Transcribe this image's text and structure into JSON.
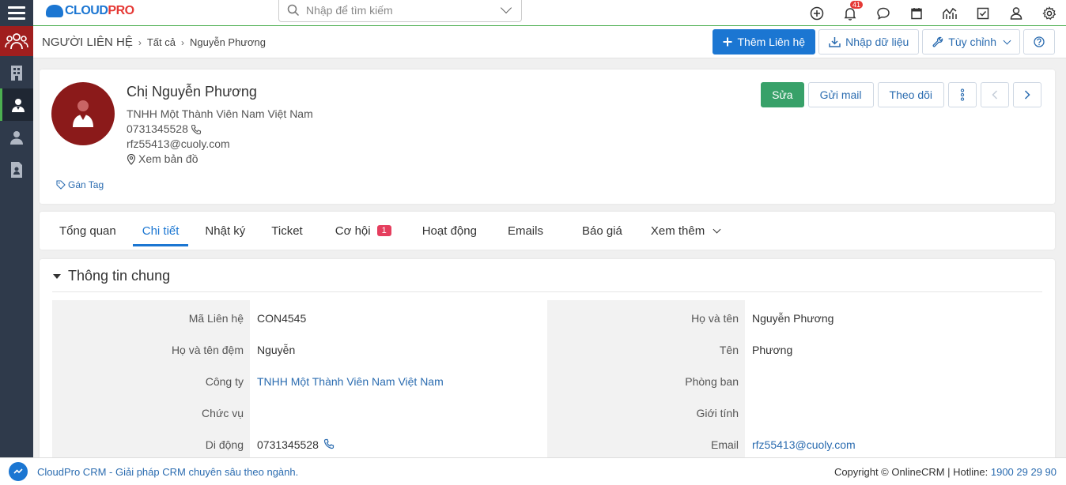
{
  "app": {
    "logo_main": "CLOUD",
    "logo_accent": "PRO"
  },
  "search": {
    "placeholder": "Nhập để tìm kiếm"
  },
  "top_icons": {
    "notification_count": "41"
  },
  "breadcrumb": {
    "module": "Người liên hệ",
    "level1": "Tất cả",
    "level2": "Nguyễn Phương"
  },
  "header_actions": {
    "add": "Thêm Liên hệ",
    "import": "Nhập dữ liệu",
    "customize": "Tùy chỉnh"
  },
  "profile": {
    "name": "Chị Nguyễn Phương",
    "company": "TNHH Một Thành Viên Nam Việt Nam",
    "phone": "0731345528",
    "email": "rfz55413@cuoly.com",
    "map": "Xem bản đồ",
    "tag": "Gán Tag",
    "actions": {
      "edit": "Sửa",
      "send_mail": "Gửi mail",
      "follow": "Theo dõi"
    }
  },
  "tabs": [
    {
      "label": "Tổng quan"
    },
    {
      "label": "Chi tiết"
    },
    {
      "label": "Nhật ký"
    },
    {
      "label": "Ticket"
    },
    {
      "label": "Cơ hội",
      "badge": "1"
    },
    {
      "label": "Hoạt động"
    },
    {
      "label": "Emails"
    },
    {
      "label": "Báo giá"
    },
    {
      "label": "Xem thêm"
    }
  ],
  "section": {
    "title": "Thông tin chung"
  },
  "fields": {
    "left": [
      {
        "label": "Mã Liên hệ",
        "value": "CON4545"
      },
      {
        "label": "Họ và tên đệm",
        "value": "Nguyễn"
      },
      {
        "label": "Công ty",
        "value": "TNHH Một Thành Viên Nam Việt Nam"
      },
      {
        "label": "Chức vụ",
        "value": ""
      },
      {
        "label": "Di động",
        "value": "0731345528"
      }
    ],
    "right": [
      {
        "label": "Họ và tên",
        "value": "Nguyễn Phương"
      },
      {
        "label": "Tên",
        "value": "Phương"
      },
      {
        "label": "Phòng ban",
        "value": ""
      },
      {
        "label": "Giới tính",
        "value": ""
      },
      {
        "label": "Email",
        "value": "rfz55413@cuoly.com"
      }
    ]
  },
  "footer": {
    "slogan": "CloudPro CRM - Giải pháp CRM chuyên sâu theo ngành.",
    "copyright": "Copyright © OnlineCRM | Hotline: ",
    "hotline": "1900 29 29 90"
  },
  "colors": {
    "primary": "#1b76d2",
    "success": "#38a169",
    "sidebar": "#2f3a4b",
    "accent_red": "#a01e1e"
  }
}
